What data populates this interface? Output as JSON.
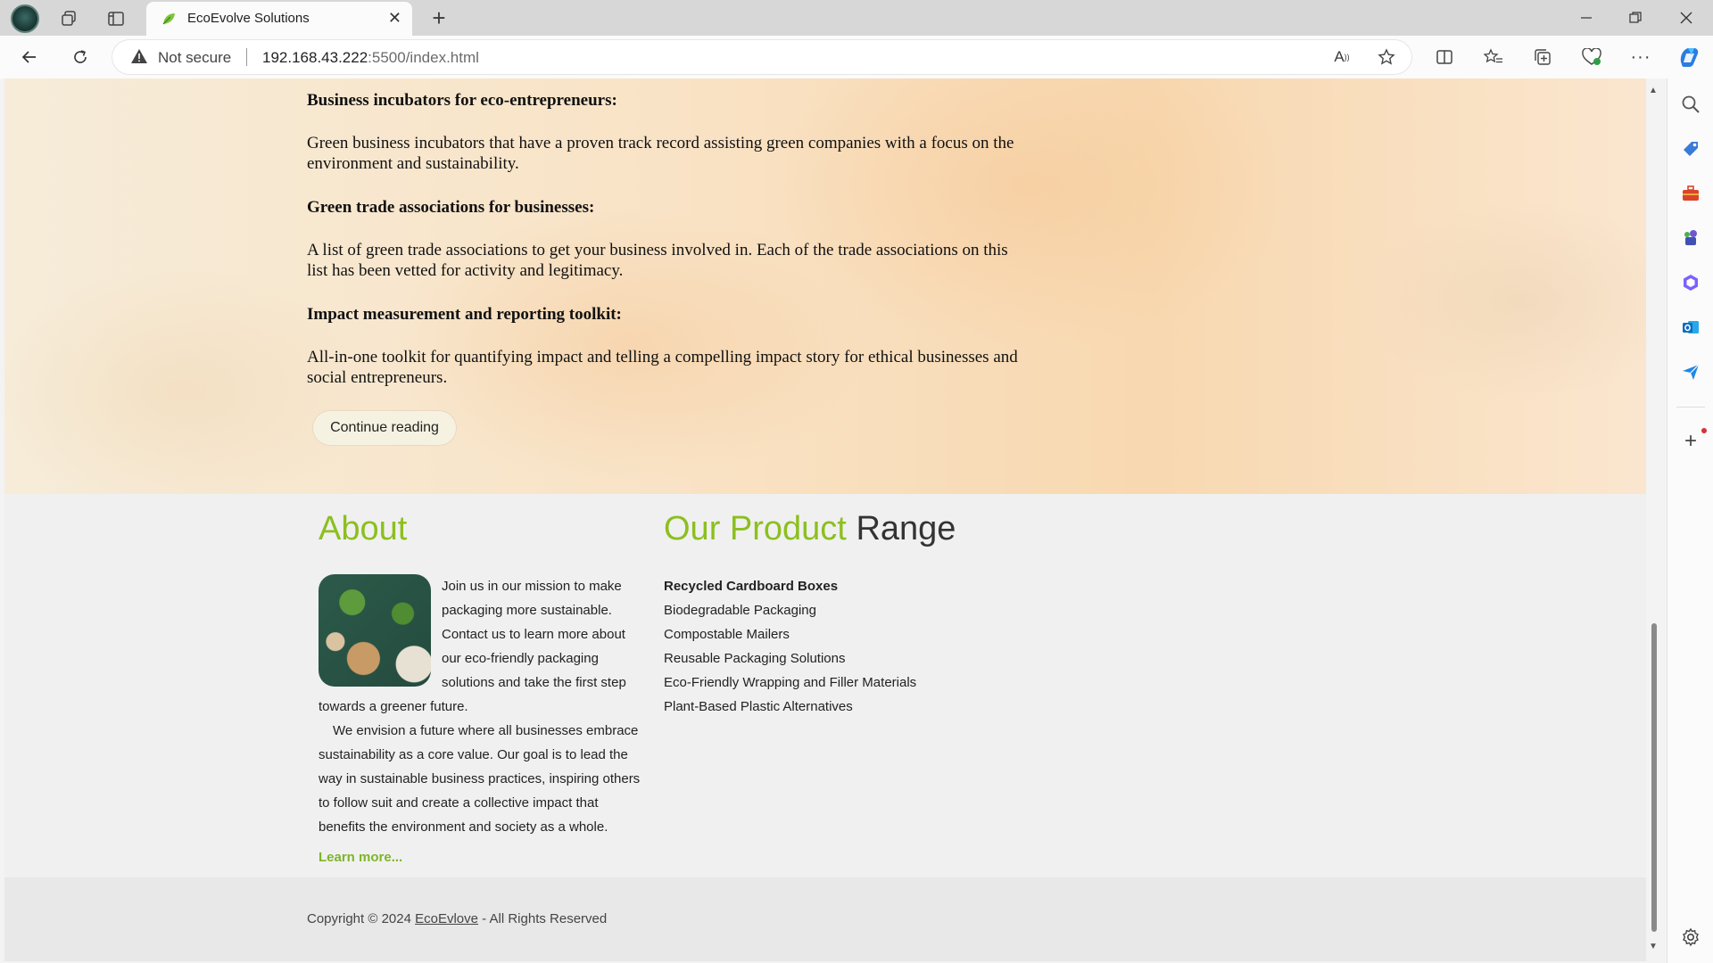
{
  "browser": {
    "tab_title": "EcoEvolve Solutions",
    "security_label": "Not secure",
    "url_host": "192.168.43.222",
    "url_rest": ":5500/index.html"
  },
  "article": {
    "sections": [
      {
        "heading": "Business incubators for eco-entrepreneurs:",
        "text": "Green business incubators that have a proven track record assisting green companies with a focus on the environment and sustainability."
      },
      {
        "heading": "Green trade associations for businesses:",
        "text": "A list of green trade associations to get your business involved in. Each of the trade associations on this list has been vetted for activity and legitimacy."
      },
      {
        "heading": "Impact measurement and reporting toolkit:",
        "text": "All-in-one toolkit for quantifying impact and telling a compelling impact story for ethical businesses and social entrepreneurs."
      }
    ],
    "continue_label": "Continue reading"
  },
  "about": {
    "title": "About",
    "text1": "Join us in our mission to make packaging more sustainable. Contact us to learn more about our eco-friendly packaging solutions and take the first step towards a greener future.",
    "text2": "We envision a future where all businesses embrace sustainability as a core value. Our goal is to lead the way in sustainable business practices, inspiring others to follow suit and create a collective impact that benefits the environment and society as a whole.",
    "learn_more": "Learn more..."
  },
  "products": {
    "title_green": "Our Product",
    "title_dark": "Range",
    "items": [
      "Recycled Cardboard Boxes",
      "Biodegradable Packaging",
      "Compostable Mailers",
      "Reusable Packaging Solutions",
      "Eco-Friendly Wrapping and Filler Materials",
      "Plant-Based Plastic Alternatives"
    ]
  },
  "footer": {
    "prefix": "Copyright © 2024 ",
    "brand": "EcoEvlove",
    "suffix": " - All Rights Reserved"
  },
  "colors": {
    "accent_green": "#8cbf1f",
    "heading_dark": "#333333"
  }
}
